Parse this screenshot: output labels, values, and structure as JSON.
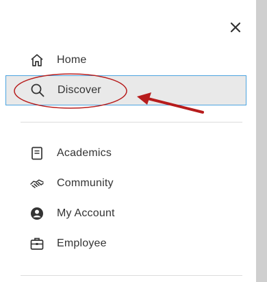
{
  "menu": {
    "items": [
      {
        "label": "Home",
        "icon": "home-icon"
      },
      {
        "label": "Discover",
        "icon": "search-icon",
        "selected": true
      },
      {
        "label": "Academics",
        "icon": "book-icon"
      },
      {
        "label": "Community",
        "icon": "handshake-icon"
      },
      {
        "label": "My Account",
        "icon": "account-icon"
      },
      {
        "label": "Employee",
        "icon": "briefcase-icon"
      }
    ]
  },
  "colors": {
    "selected_background": "#e9e9e9",
    "selected_border": "#4aa3df",
    "annotation": "#b71c1c",
    "text": "#333333"
  }
}
